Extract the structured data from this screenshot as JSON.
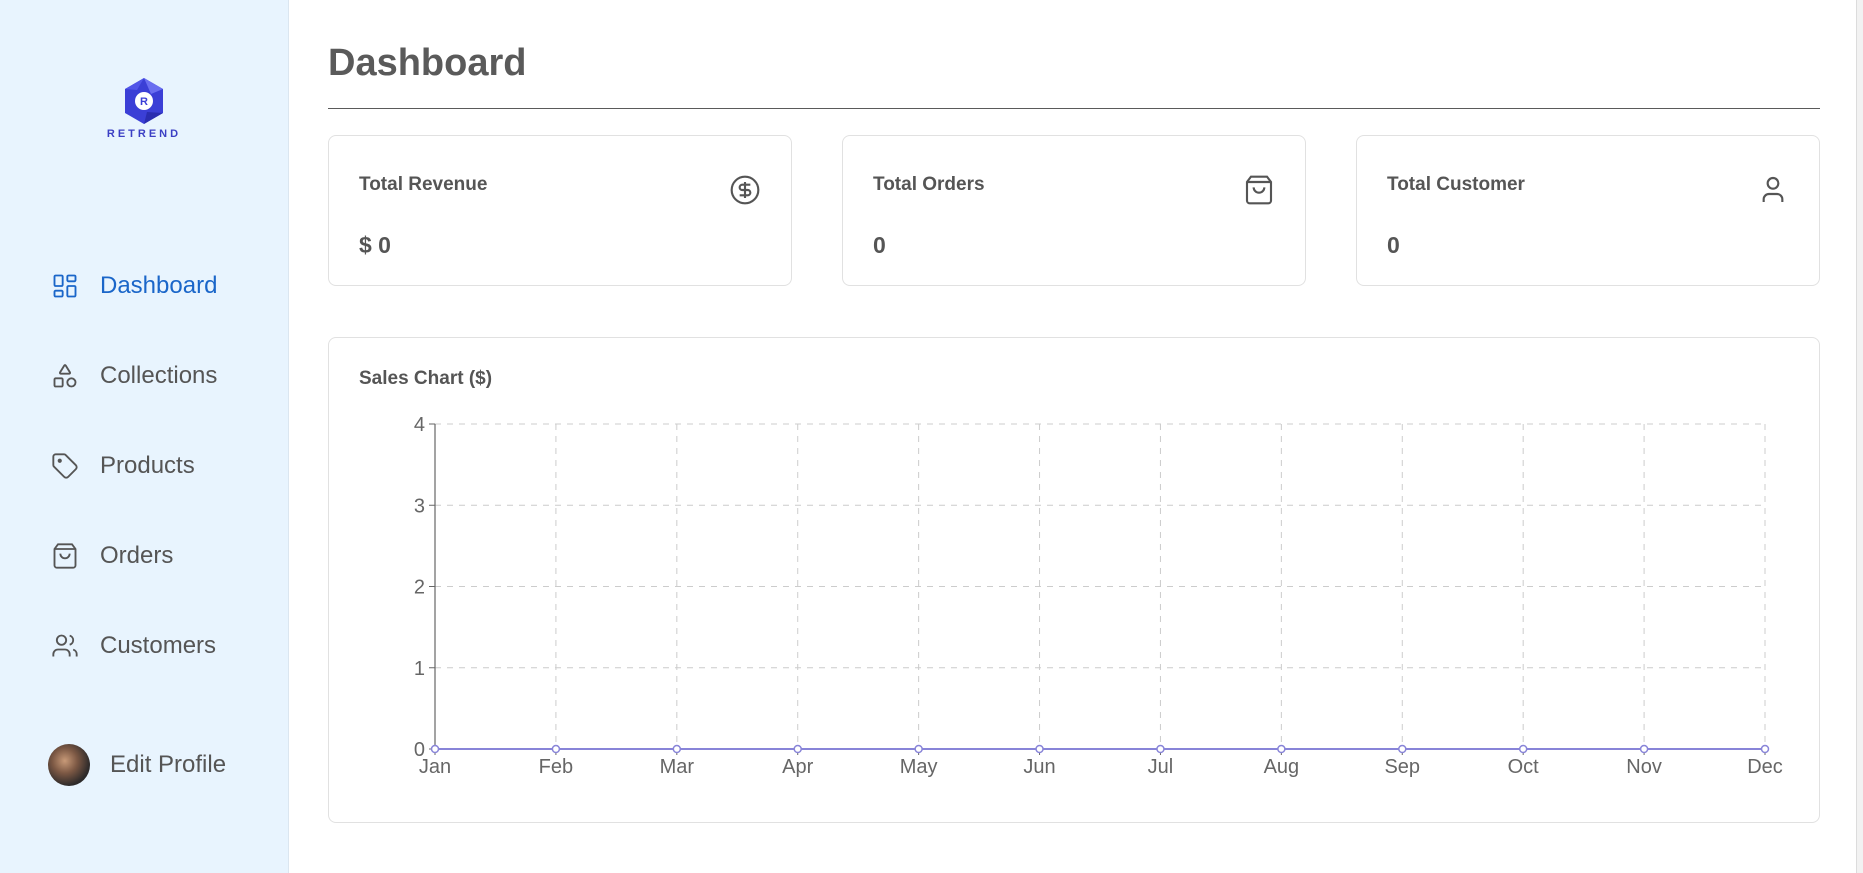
{
  "brand": {
    "name": "RETREND",
    "mark": "R"
  },
  "sidebar": {
    "items": [
      {
        "label": "Dashboard",
        "icon": "dashboard-icon",
        "active": true
      },
      {
        "label": "Collections",
        "icon": "shapes-icon",
        "active": false
      },
      {
        "label": "Products",
        "icon": "tag-icon",
        "active": false
      },
      {
        "label": "Orders",
        "icon": "shopping-bag-icon",
        "active": false
      },
      {
        "label": "Customers",
        "icon": "users-icon",
        "active": false
      }
    ],
    "profile": {
      "label": "Edit Profile"
    }
  },
  "page": {
    "title": "Dashboard"
  },
  "cards": [
    {
      "title": "Total Revenue",
      "value": "$ 0",
      "icon": "dollar-circle-icon"
    },
    {
      "title": "Total Orders",
      "value": "0",
      "icon": "shopping-bag-icon"
    },
    {
      "title": "Total Customer",
      "value": "0",
      "icon": "user-icon"
    }
  ],
  "colors": {
    "accent": "#1a66c9",
    "sidebar_bg": "#e8f4fe",
    "series_line": "#8884d8",
    "grid": "#cccccc"
  },
  "chart_data": {
    "type": "line",
    "title": "Sales Chart ($)",
    "categories": [
      "Jan",
      "Feb",
      "Mar",
      "Apr",
      "May",
      "Jun",
      "Jul",
      "Aug",
      "Sep",
      "Oct",
      "Nov",
      "Dec"
    ],
    "series": [
      {
        "values": [
          0,
          0,
          0,
          0,
          0,
          0,
          0,
          0,
          0,
          0,
          0,
          0
        ]
      }
    ],
    "yticks": [
      0,
      1,
      2,
      3,
      4
    ],
    "ylim": [
      0,
      4
    ],
    "grid": true,
    "xlabel": "",
    "ylabel": ""
  }
}
